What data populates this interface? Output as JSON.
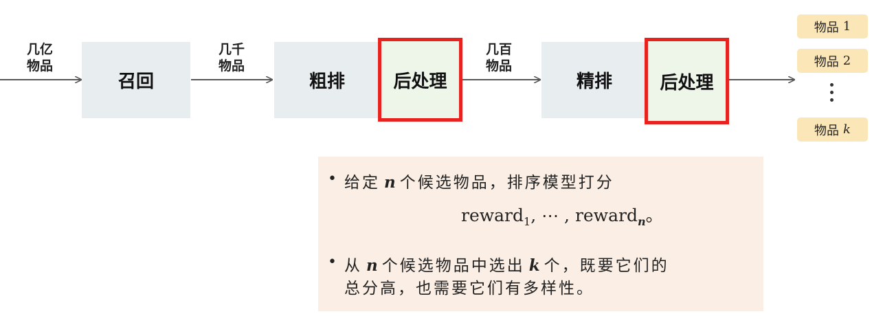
{
  "pipeline": {
    "input_label": [
      "几亿",
      "物品"
    ],
    "stages": {
      "recall": "召回",
      "coarse_rank": "粗排",
      "post1": "后处理",
      "fine_rank": "精排",
      "post2": "后处理"
    },
    "label_after_recall": [
      "几千",
      "物品"
    ],
    "label_after_coarse": [
      "几百",
      "物品"
    ]
  },
  "outputs": {
    "item_text": "物品",
    "items": [
      {
        "num": "1"
      },
      {
        "num": "2"
      },
      {
        "num": "k"
      }
    ]
  },
  "note": {
    "b1_pre": "给定",
    "b1_var": "n",
    "b1_post": "个候选物品，排序模型打分",
    "formula_word": "reward",
    "formula_sub1": "1",
    "formula_mid": ", ⋯ , ",
    "formula_subn": "n",
    "formula_end": "。",
    "b2_pre": "从",
    "b2_var1": "n",
    "b2_mid": "个候选物品中选出",
    "b2_var2": "k",
    "b2_post": "个，既要它们的",
    "b2_line2": "总分高，也需要它们有多样性。"
  },
  "colors": {
    "stage_bg": "#e8edf0",
    "post_bg": "#eef6ea",
    "post_border": "#e8231f",
    "item_bg": "#fbe6b8",
    "note_bg": "#fbeee4",
    "arrow": "#555555"
  }
}
